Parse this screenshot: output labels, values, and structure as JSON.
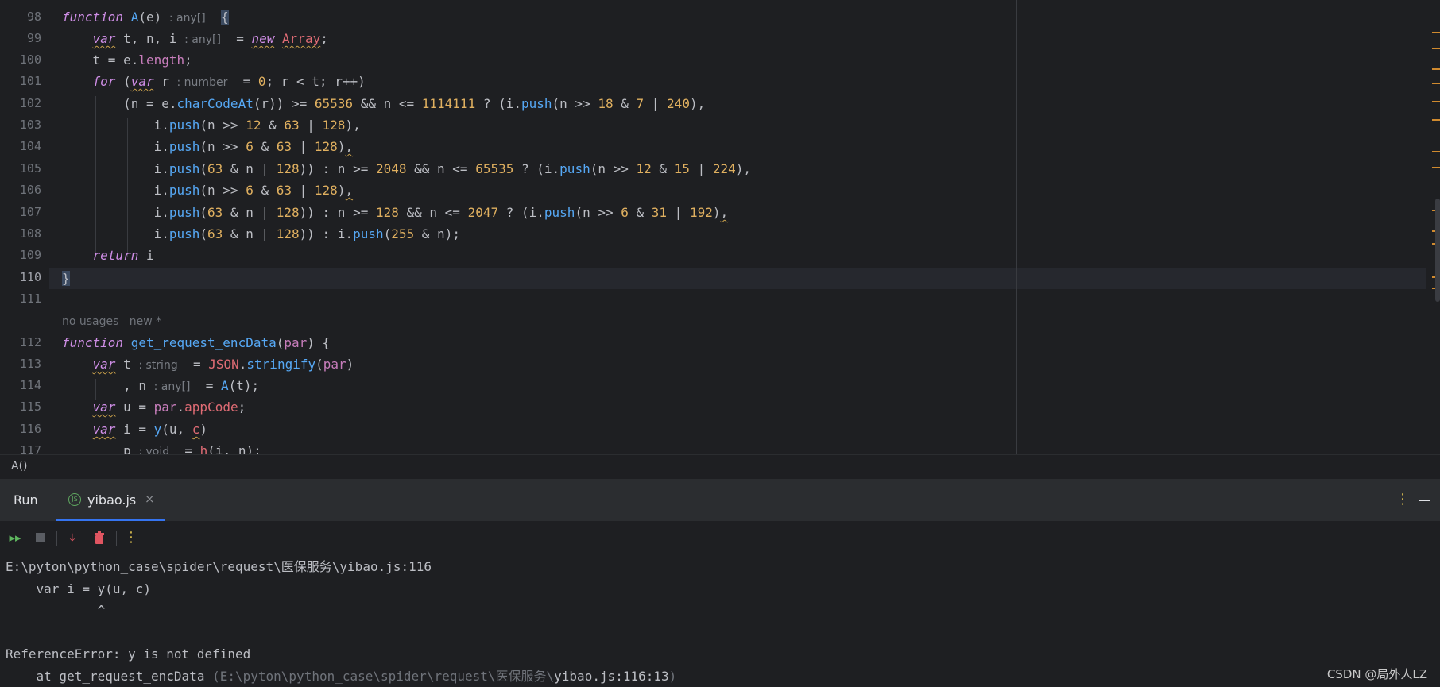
{
  "editor": {
    "line_numbers": [
      "98",
      "99",
      "100",
      "101",
      "102",
      "103",
      "104",
      "105",
      "106",
      "107",
      "108",
      "109",
      "110",
      "111",
      "112",
      "113",
      "114",
      "115",
      "116",
      "117"
    ],
    "inlay_hints": {
      "hint_98": ": any[]",
      "hint_99": ": any[]",
      "hint_101": ": number",
      "hint_113": ": string",
      "hint_114": ": any[]",
      "hint_117": ": void"
    },
    "code_vision": {
      "usages": "no usages",
      "new_label": "new *"
    }
  },
  "breadcrumb": {
    "label": "A()"
  },
  "run_panel": {
    "title": "Run",
    "tab_label": "yibao.js",
    "close_glyph": "×",
    "console": {
      "line_1": "E:\\pyton\\python_case\\spider\\request\\医保服务\\yibao.js:116",
      "line_2": "    var i = y(u, c)",
      "line_3": "            ^",
      "line_4": "",
      "line_5": "ReferenceError: y is not defined",
      "line_6_prefix": "    at get_request_encData ",
      "line_6_path": "(E:\\pyton\\python_case\\spider\\request\\医保服务\\",
      "line_6_link": "yibao.js:116:13",
      "line_6_suffix": ")"
    }
  },
  "watermark": "CSDN @局外人LZ",
  "colors": {
    "background": "#1e1f22",
    "keyword": "#cf8ee6",
    "function": "#56a8f5",
    "number": "#e0b060",
    "property": "#c77dbb",
    "accent": "#3574f0"
  },
  "icons": {
    "rerun": "rerun-icon",
    "stop": "stop-icon",
    "scroll_to_end": "scroll-to-end-icon",
    "clear": "trash-icon",
    "more": "kebab-menu-icon",
    "minimize": "minimize-icon"
  }
}
